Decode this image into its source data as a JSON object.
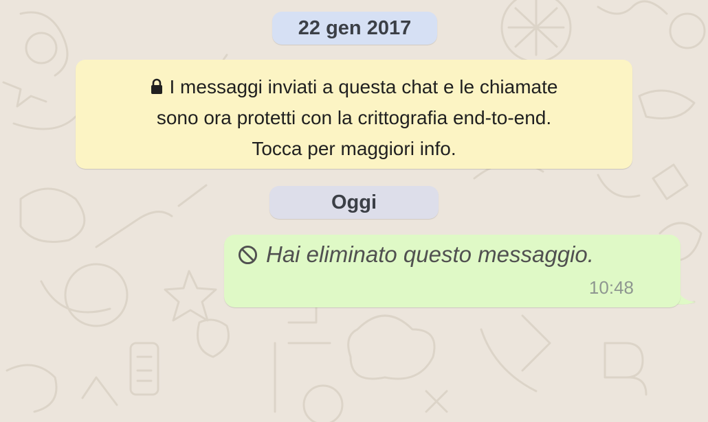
{
  "chat": {
    "date_separator_1": "22 gen 2017",
    "encryption_notice": {
      "line1": "I messaggi inviati a questa chat e le chiamate",
      "line2": "sono ora protetti con la crittografia end-to-end.",
      "line3": "Tocca per maggiori info."
    },
    "date_separator_2": "Oggi",
    "messages": [
      {
        "direction": "outgoing",
        "icon": "ban-icon",
        "text": "Hai eliminato questo messaggio.",
        "time": "10:48"
      }
    ]
  },
  "colors": {
    "background": "#ece5dc",
    "notice_background": "#fcf4c4",
    "outgoing_bubble": "#dff9c6",
    "date_pill_first": "#d6e0f4",
    "date_pill_today": "#dddeea"
  },
  "icons": [
    "lock-icon",
    "ban-icon"
  ]
}
